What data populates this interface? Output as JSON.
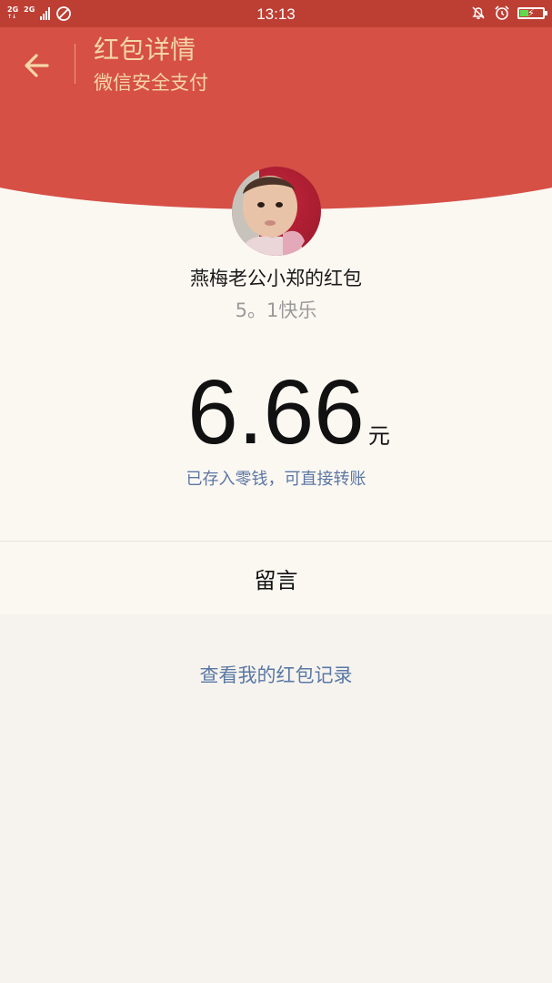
{
  "status_bar": {
    "network_1": "2G",
    "network_2": "2G",
    "time": "13:13"
  },
  "header": {
    "title": "红包详情",
    "subtitle": "微信安全支付",
    "bg_color": "#d65046",
    "text_color": "#f5d6a6"
  },
  "packet": {
    "sender": "燕梅老公小郑的红包",
    "greeting": "5。1快乐",
    "amount": "6.66",
    "unit": "元",
    "saved_note": "已存入零钱，可直接转账"
  },
  "actions": {
    "message_label": "留言",
    "records_link": "查看我的红包记录"
  },
  "icons": [
    "back-arrow-icon",
    "avatar",
    "do-not-disturb-icon",
    "mute-icon",
    "alarm-icon",
    "battery-icon"
  ],
  "colors": {
    "link": "#5a78a6",
    "status_bar": "#bd3f33"
  }
}
